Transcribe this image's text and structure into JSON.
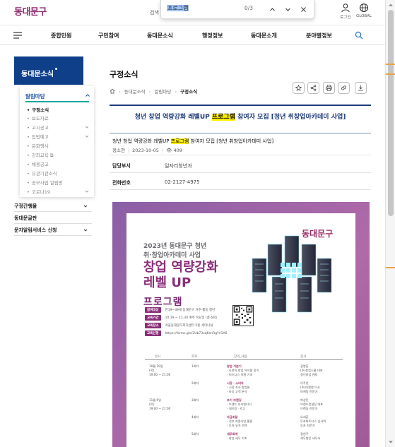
{
  "header": {
    "logo_text": "동대문구",
    "search_hint": "검색",
    "login_label": "로그인",
    "global_label": "GLOBAL"
  },
  "find_bar": {
    "query": "프로그램",
    "count": "0/3"
  },
  "gnb": {
    "items": [
      "종합민원",
      "구민참여",
      "동대문소식",
      "행정정보",
      "동대문소개",
      "분야별정보"
    ]
  },
  "sidebar": {
    "title": "동대문소식",
    "category": "알림마당",
    "items": [
      {
        "label": "구정소식",
        "active": true,
        "expandable": false
      },
      {
        "label": "보도자료",
        "active": false,
        "expandable": false
      },
      {
        "label": "고시공고",
        "active": false,
        "expandable": true
      },
      {
        "label": "입법예고",
        "active": false,
        "expandable": true
      },
      {
        "label": "문화행사",
        "active": false,
        "expandable": false
      },
      {
        "label": "강좌교육",
        "active": false,
        "expandable": false
      },
      {
        "label": "채용공고",
        "active": false,
        "expandable": false
      },
      {
        "label": "유관기관소식",
        "active": false,
        "expandable": false
      },
      {
        "label": "공모사업 알림방",
        "active": false,
        "expandable": false
      },
      {
        "label": "코로나19",
        "active": false,
        "expandable": true
      }
    ],
    "menus": [
      {
        "label": "구정간행물",
        "expandable": true
      },
      {
        "label": "동대문글판",
        "expandable": false
      },
      {
        "label": "문자알림서비스 신청",
        "expandable": true
      }
    ]
  },
  "page": {
    "title": "구정소식",
    "breadcrumb": [
      "동대문소식",
      "알림마당",
      "구정소식"
    ]
  },
  "article": {
    "headline_before": "청년 창업 역량강화 레벨UP ",
    "headline_highlight": "프로그램",
    "headline_after": " 참여자 모집 [청년 취창업아카데미 사업]",
    "post_title_before": "청년 창업 역량강화 레벨UP ",
    "post_title_highlight": "프로그램",
    "post_title_after": " 참여자 모집 [청년 취창업아카데미 사업]",
    "author": "정소현",
    "date": "2023-10-05",
    "views": "409",
    "dept_label": "담당부서",
    "dept_value": "일자리청년과",
    "phone_label": "전화번호",
    "phone_value": "02-2127-4975"
  },
  "poster": {
    "logo": "동대문구",
    "subtitle_line1": "2023년 동대문구 청년",
    "subtitle_line2": "취·창업아카데미 사업",
    "main_line1": "창업 역량강화",
    "main_line2": "레벨 UP",
    "program": "프로그램",
    "tags": [
      {
        "tag": "참여대상",
        "text": "만19~39세 동대문구 거주·활동 청년"
      },
      {
        "tag": "교육기간",
        "text": "10.19 ~ 11.30 매주 목요일 (총 6회)"
      },
      {
        "tag": "교육장소",
        "text": "서울동대문디피디센터 5층 세미나실"
      },
      {
        "tag": "교육신청",
        "text": "https://forms.gle/2Ub73xq6enRgYn1A6"
      }
    ],
    "schedule_headers": [
      "일시",
      "회차",
      "강의_내용",
      "강사"
    ],
    "schedule_rows": [
      {
        "date": "10월 19일\n(목)\n19:00 ~ 21:00",
        "round": "1회차",
        "content": "창업 기본기\n- 나만의 창업 아이템 찾기\n- 비즈니스 모델 기초",
        "lecturer": "김병훈\n(주)창업스쿨 대표\n청년창업 멘토"
      },
      {
        "date": "",
        "round": "2회차",
        "content": "시장 · 소비자\n- 시장 조사 방법론\n- 타깃 고객 분석",
        "lecturer": "이주연\n(주)마켓랩 이사\n마케팅 전문가"
      },
      {
        "date": "11월 9일\n(목)\n19:00 ~ 21:00",
        "round": "3회차",
        "content": "초기 브랜딩\n- 브랜드 아이덴티티\n- 네이밍 · 로고",
        "lecturer": "박성민\n브랜드컨설팅 대표\n브랜딩 전문가"
      },
      {
        "date": "",
        "round": "4회차",
        "content": "자금조달\n- 정부 지원사업 활용\n- 투자 유치 전략",
        "lecturer": "오세훈\n투자파트너스 심사역\n투자 전문가"
      },
      {
        "date": "",
        "round": "5회차",
        "content": "세무회계\n- 창업 세무 기초",
        "lecturer": "정현주\n세무법인 세무사"
      }
    ]
  },
  "colors": {
    "brand_blue": "#103f8a",
    "accent_teal": "#19a7a0",
    "highlight_yellow": "#ffee00",
    "poster_purple": "#8a2e7a"
  },
  "icons": {
    "login": "user-icon",
    "global": "globe-icon",
    "menu": "hamburger-icon",
    "search": "search-icon",
    "home": "home-icon"
  }
}
